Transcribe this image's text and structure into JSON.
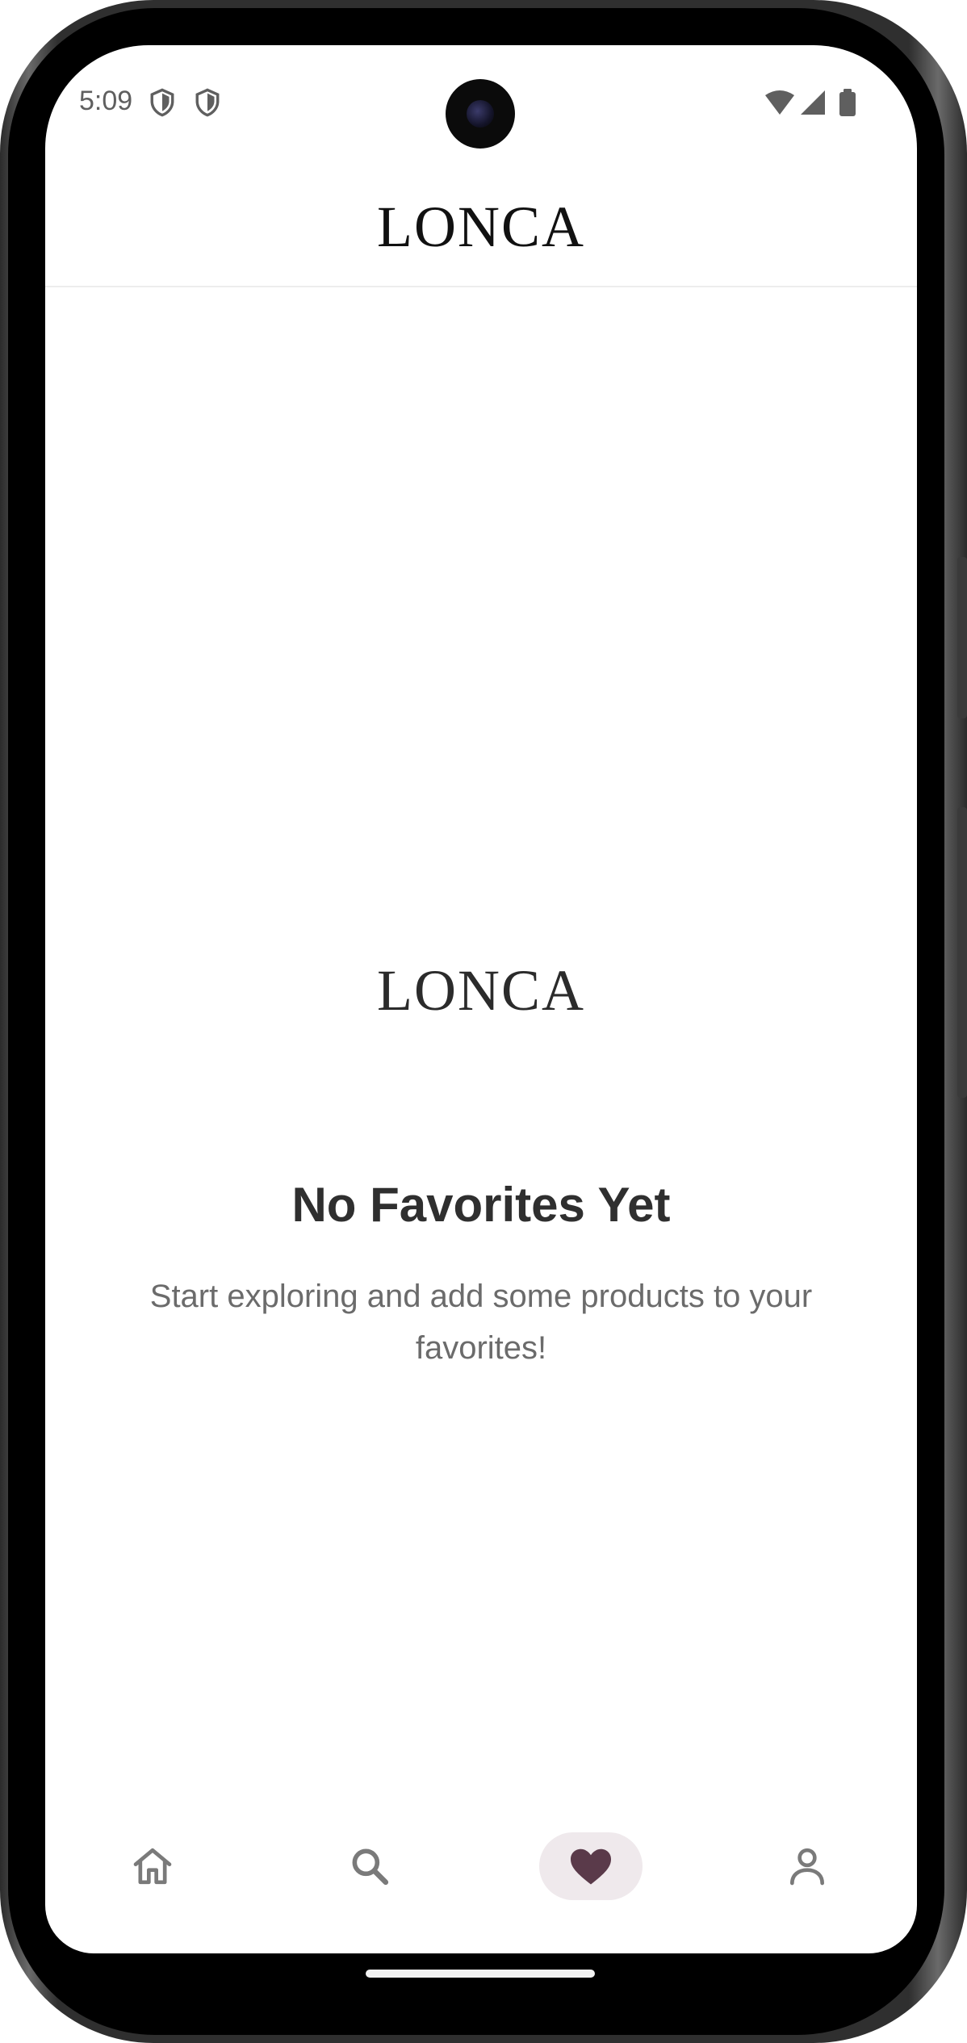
{
  "status_bar": {
    "time": "5:09",
    "notification_icons": [
      "shield-icon",
      "shield-icon"
    ],
    "system_icons": [
      "wifi-icon",
      "signal-icon",
      "battery-icon"
    ]
  },
  "header": {
    "logo_text": "LONCA"
  },
  "empty_state": {
    "logo_text": "LONCA",
    "title": "No Favorites Yet",
    "message": "Start exploring and add some products to your favorites!"
  },
  "bottom_nav": {
    "items": [
      {
        "name": "home",
        "icon": "home-icon",
        "active": false
      },
      {
        "name": "search",
        "icon": "search-icon",
        "active": false
      },
      {
        "name": "favorites",
        "icon": "heart-icon",
        "active": true
      },
      {
        "name": "profile",
        "icon": "person-icon",
        "active": false
      }
    ],
    "active_color": "#5a3a4a",
    "inactive_color": "#7a7a7a",
    "active_pill_color": "#efe9ec"
  }
}
